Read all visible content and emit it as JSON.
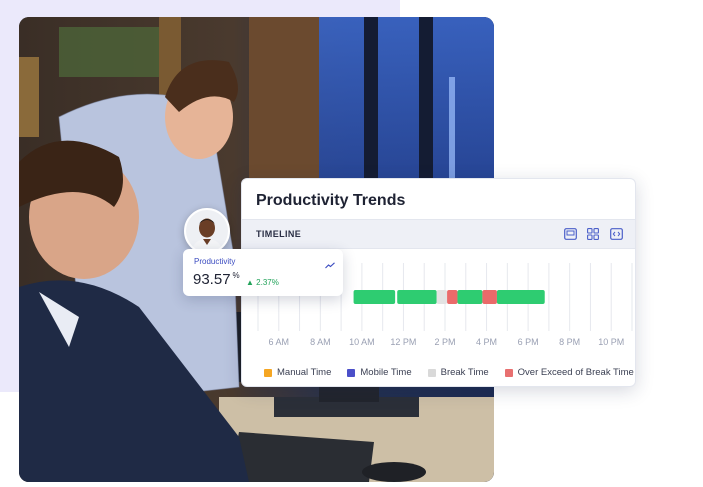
{
  "card": {
    "title": "Productivity Trends",
    "timeline_label": "TIMELINE",
    "icons": [
      "screen-icon",
      "grid-icon",
      "code-icon"
    ]
  },
  "productivity": {
    "label": "Productivity",
    "value": "93.57",
    "unit": "%",
    "change": "2.37%",
    "change_arrow": "▲"
  },
  "timeline": {
    "ticks": [
      "6 AM",
      "8 AM",
      "10 AM",
      "12 PM",
      "2 PM",
      "4 PM",
      "6 PM",
      "8 PM",
      "10 PM"
    ],
    "segments": [
      {
        "type": "productive",
        "start": 9.6,
        "end": 11.6
      },
      {
        "type": "productive",
        "start": 11.7,
        "end": 13.6
      },
      {
        "type": "break",
        "start": 13.6,
        "end": 14.1
      },
      {
        "type": "over_exceed",
        "start": 14.1,
        "end": 14.6
      },
      {
        "type": "productive",
        "start": 14.6,
        "end": 15.8
      },
      {
        "type": "over_exceed",
        "start": 15.8,
        "end": 16.5
      },
      {
        "type": "productive",
        "start": 16.5,
        "end": 18.8
      }
    ]
  },
  "legend": [
    {
      "label": "Manual Time",
      "color": "#f5a623"
    },
    {
      "label": "Mobile Time",
      "color": "#4b4fc9"
    },
    {
      "label": "Break Time",
      "color": "#d9d9d9"
    },
    {
      "label": "Over Exceed of Break Time",
      "color": "#e87070"
    }
  ],
  "colors": {
    "productive": "#2ecc71",
    "break": "#e3e3e3",
    "over_exceed": "#ea6a6a",
    "accent": "#3b4cc0",
    "positive": "#22a35a"
  }
}
